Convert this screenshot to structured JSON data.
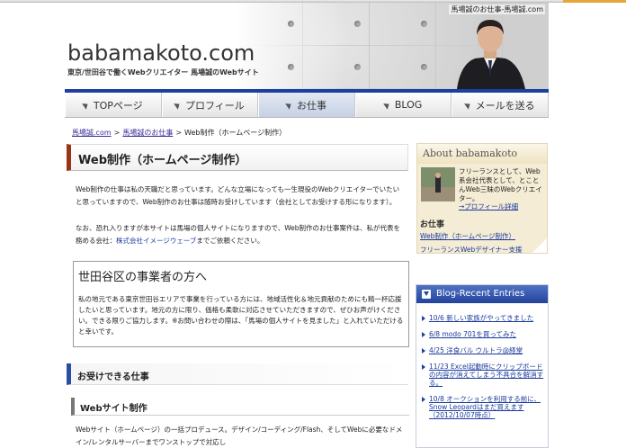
{
  "header": {
    "credit": "馬場誠のお仕事-馬場誠.com",
    "site_title": "babamakoto.com",
    "subtitle": "東京/世田谷で働くWebクリエイター 馬場誠のWebサイト"
  },
  "nav": {
    "items": [
      {
        "label": "TOPページ"
      },
      {
        "label": "プロフィール"
      },
      {
        "label": "お仕事"
      },
      {
        "label": "BLOG"
      },
      {
        "label": "メールを送る"
      }
    ],
    "active_index": 2
  },
  "breadcrumb": {
    "home": "馬場誠.com",
    "work": "馬場誠のお仕事",
    "current": "Web制作（ホームページ制作）",
    "separator": ">"
  },
  "main": {
    "heading": "Web制作（ホームページ制作）",
    "p1": "Web制作の仕事は私の天職だと思っています。どんな立場になっても一生現役のWebクリエイターでいたいと思っていますので、Web制作のお仕事は随時お受けしています（会社としてお受けする形になります）。",
    "p2_before": "なお、恐れ入りますが本サイトは馬場の個人サイトになりますので、Web制作のお仕事案件は、私が代表を務める会社：",
    "p2_link": "株式会社イメージウェーブ",
    "p2_after": "までご依頼ください。",
    "box_title": "世田谷区の事業者の方へ",
    "box_text": "私の地元である東京世田谷エリアで事業を行っている方には、地域活性化＆地元貢献のためにも精一杯応援したいと思っています。地元の方に限り、価格も柔軟に対応させていただきますので、ぜひお声がけください。できる限りご協力します。※お問い合わせの際は、「馬場の個人サイトを見ました」と入れていただけると幸いです。",
    "section_heading": "お受けできる仕事",
    "sub_heading": "Webサイト制作",
    "p3": "Webサイト（ホームページ）の一括プロデュース。デザイン/コーディング/Flash、そしてWebに必要なドメイン/レンタルサーバーまでワンストップで対応し"
  },
  "sidebar": {
    "about_title": "About babamakoto",
    "about_text": "フリーランスとして、Web系会社代表として、とことんWeb三昧のWebクリエイター。",
    "about_link": "→プロフィール詳細",
    "work_heading": "お仕事",
    "work_links": [
      "Web制作（ホームページ制作）",
      "フリーランスWebデザイナー支援"
    ],
    "recent_title": "Blog-Recent Entries",
    "recent_entries": [
      "10/6 新しい家族がやってきました",
      "6/8 modo 701を買ってみた",
      "4/25 洋食バル ウルトラ@経堂",
      "11/23 Excel起動時にクリップボードの内容が消えてしまう不具合を解消する。",
      "10/8 オークションを利用する前に、Snow Leopardはまだ買えます（2012/10/07時点）"
    ]
  },
  "colors": {
    "accent_blue": "#1d3f9f",
    "heading_red": "#9a3414"
  }
}
